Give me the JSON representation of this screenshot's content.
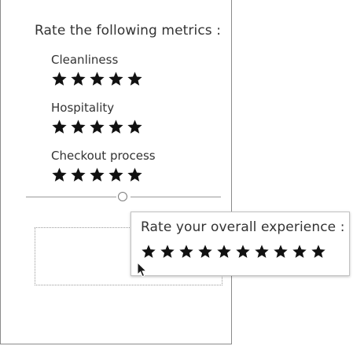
{
  "survey": {
    "title": "Rate the following metrics :",
    "metrics": [
      {
        "label": "Cleanliness",
        "max_stars": 5
      },
      {
        "label": "Hospitality",
        "max_stars": 5
      },
      {
        "label": "Checkout process",
        "max_stars": 5
      }
    ]
  },
  "dragged_item": {
    "title": "Rate your overall experience :",
    "max_stars": 10
  },
  "icons": {
    "star": "star-icon",
    "divider_handle": "circle-icon",
    "cursor": "arrow-cursor-icon"
  },
  "colors": {
    "text": "#333333",
    "star": "#111111",
    "border": "#8a8a8a"
  }
}
